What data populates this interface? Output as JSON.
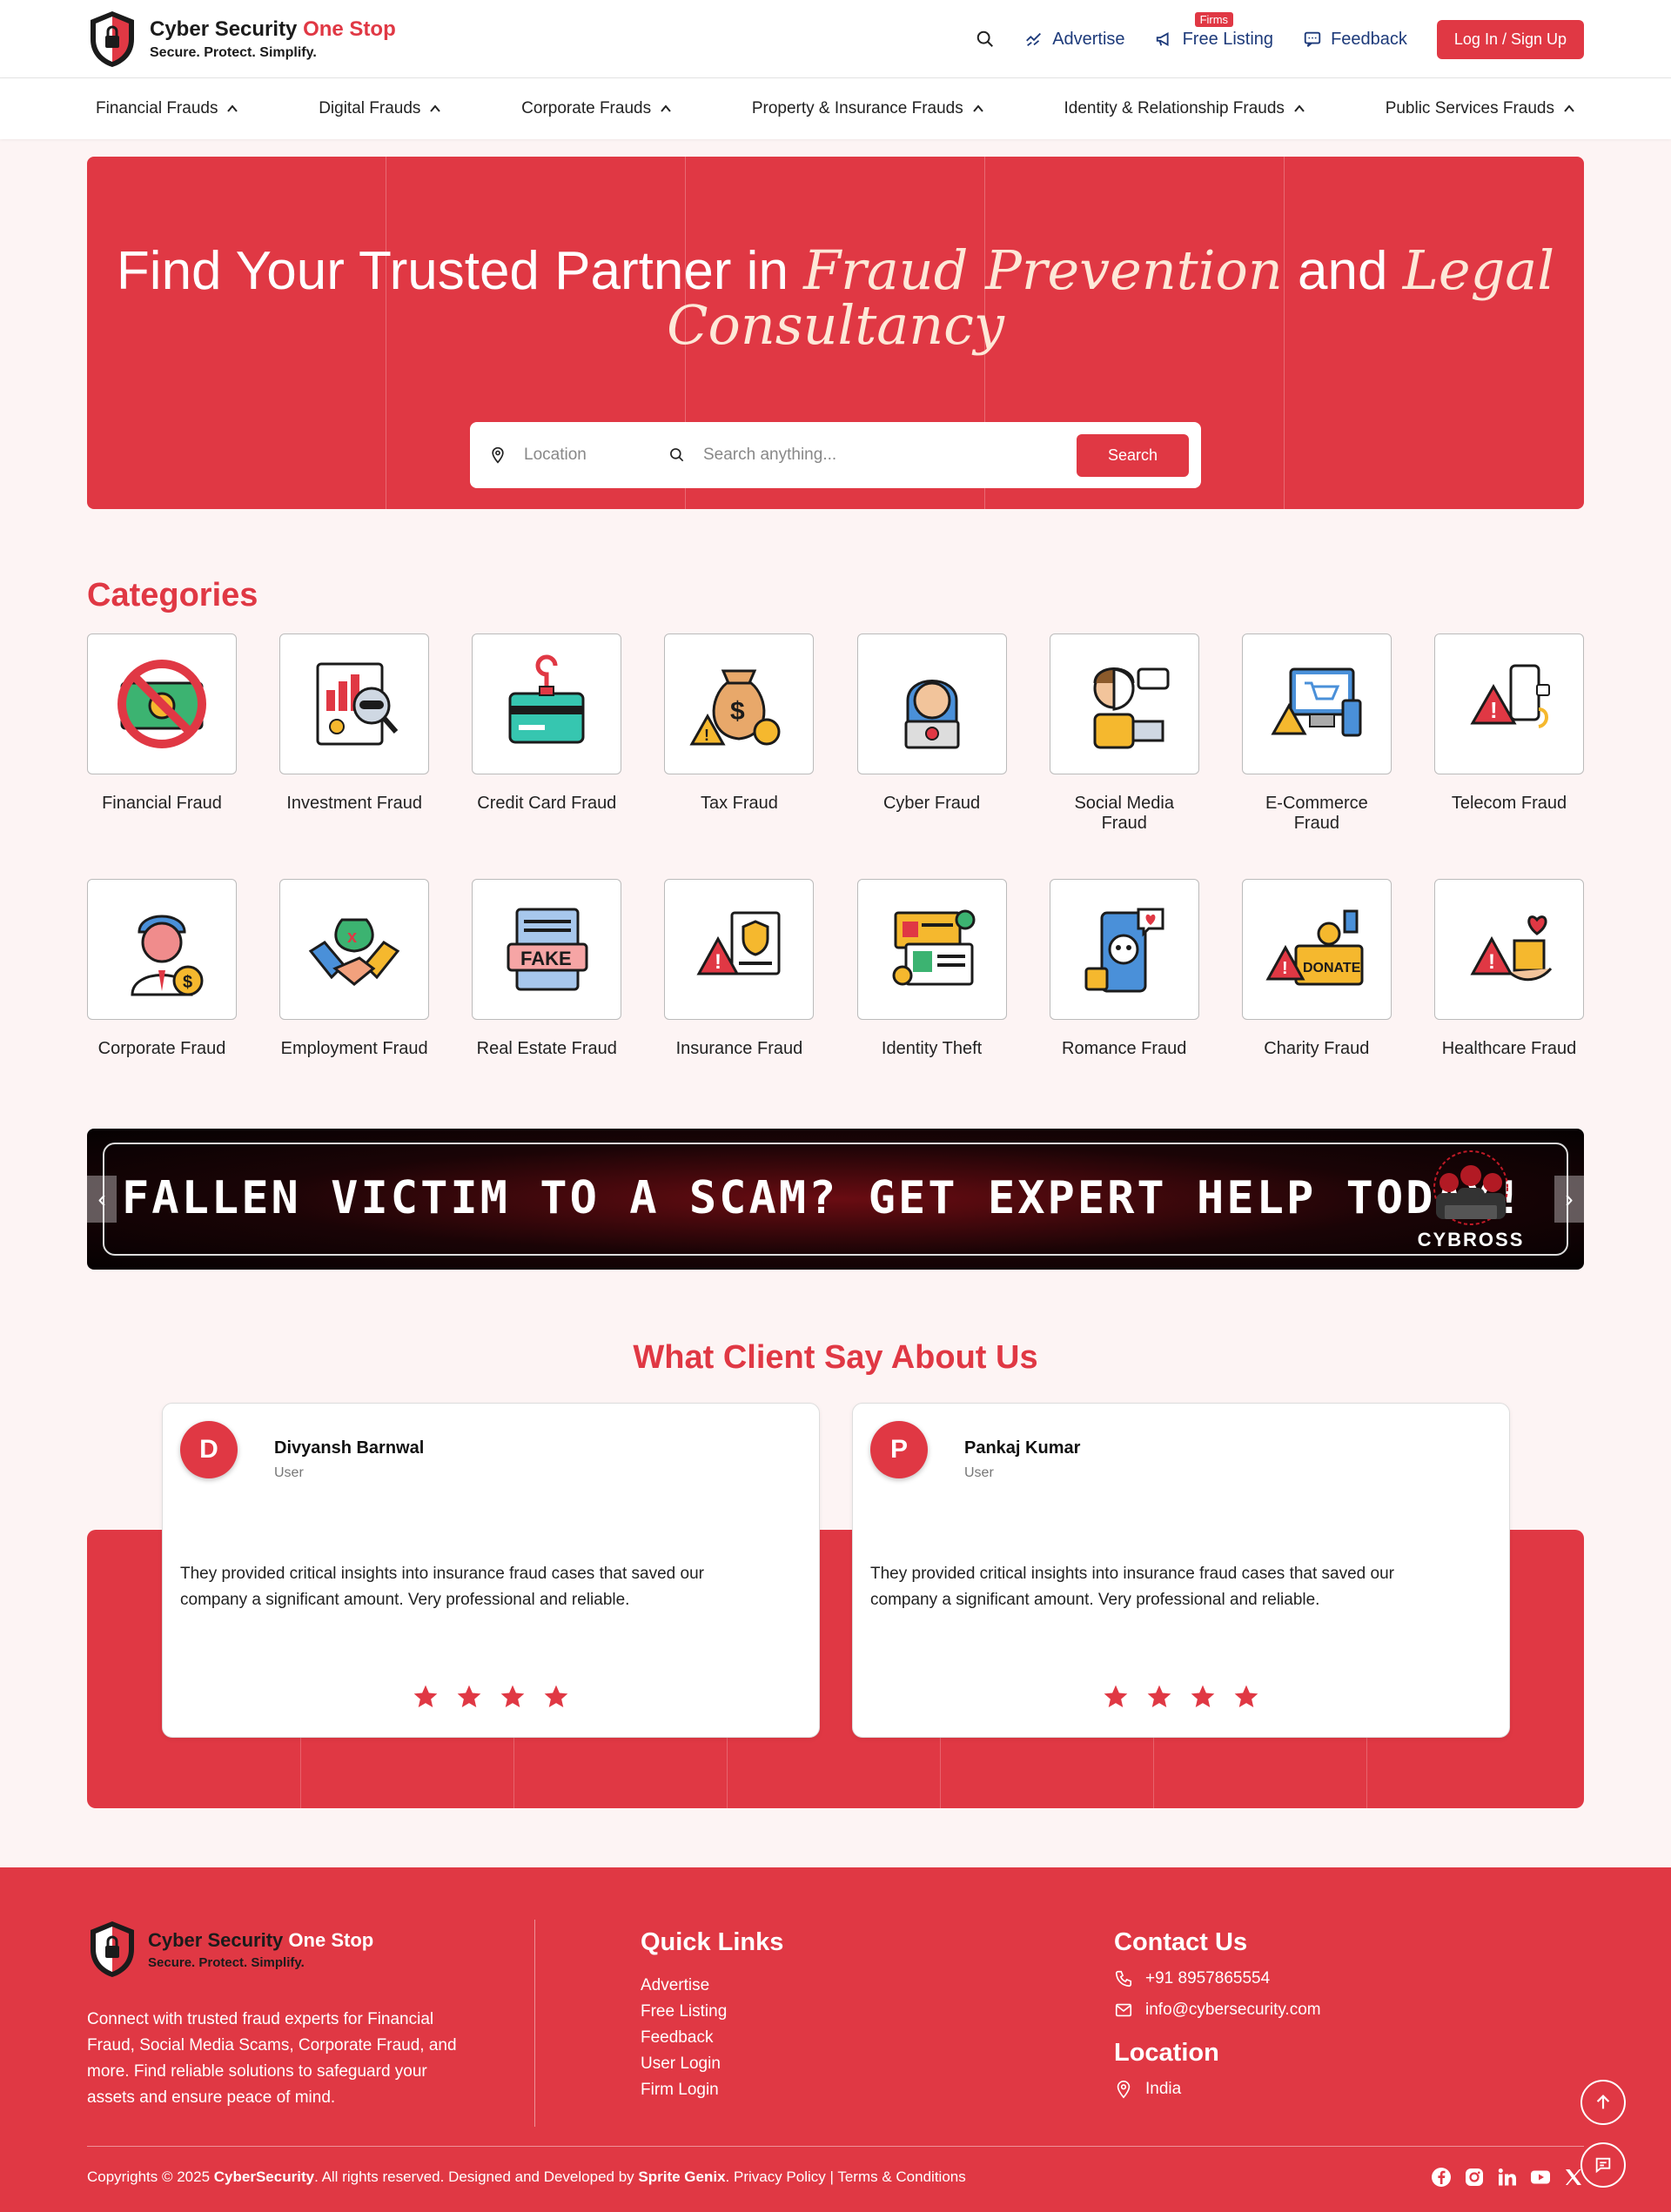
{
  "header": {
    "brand_main": "Cyber Security",
    "brand_accent": "One Stop",
    "tagline": "Secure. Protect. Simplify.",
    "advertise": "Advertise",
    "free_listing": "Free Listing",
    "firms_badge": "Firms",
    "feedback": "Feedback",
    "login": "Log In / Sign Up"
  },
  "nav": [
    "Financial Frauds",
    "Digital Frauds",
    "Corporate Frauds",
    "Property & Insurance Frauds",
    "Identity & Relationship Frauds",
    "Public Services Frauds"
  ],
  "hero": {
    "title_a": "Find Your Trusted Partner in ",
    "title_b": "Fraud Prevention",
    "title_c": " and ",
    "title_d": "Legal Consultancy",
    "location_placeholder": "Location",
    "search_placeholder": "Search anything...",
    "search_button": "Search"
  },
  "categories": {
    "title": "Categories",
    "items": [
      {
        "label": "Financial Fraud",
        "icon": "no-money-icon"
      },
      {
        "label": "Investment Fraud",
        "icon": "investment-report-icon"
      },
      {
        "label": "Credit Card Fraud",
        "icon": "credit-card-hook-icon"
      },
      {
        "label": "Tax Fraud",
        "icon": "money-bag-warning-icon"
      },
      {
        "label": "Cyber Fraud",
        "icon": "hacker-laptop-icon"
      },
      {
        "label": "Social Media Fraud",
        "icon": "social-media-mask-icon"
      },
      {
        "label": "E-Commerce Fraud",
        "icon": "ecommerce-warning-icon"
      },
      {
        "label": "Telecom Fraud",
        "icon": "phone-warning-icon"
      },
      {
        "label": "Corporate Fraud",
        "icon": "corporate-man-icon"
      },
      {
        "label": "Employment Fraud",
        "icon": "handshake-bag-icon"
      },
      {
        "label": "Real Estate Fraud",
        "icon": "fake-document-icon"
      },
      {
        "label": "Insurance Fraud",
        "icon": "insurance-warning-icon"
      },
      {
        "label": "Identity Theft",
        "icon": "identity-cards-icon"
      },
      {
        "label": "Romance Fraud",
        "icon": "romance-skull-phone-icon"
      },
      {
        "label": "Charity Fraud",
        "icon": "donate-box-icon"
      },
      {
        "label": "Healthcare Fraud",
        "icon": "healthcare-warning-icon"
      }
    ]
  },
  "banner": {
    "text": "FALLEN VICTIM TO A SCAM? GET EXPERT HELP TODAY!",
    "logo_text": "CYBROSS"
  },
  "testimonials": {
    "title": "What Client Say About Us",
    "items": [
      {
        "initial": "D",
        "name": "Divyansh Barnwal",
        "role": "User",
        "text": "They provided critical insights into insurance fraud cases that saved our company a significant amount. Very professional and reliable.",
        "stars": 4
      },
      {
        "initial": "P",
        "name": "Pankaj Kumar",
        "role": "User",
        "text": "They provided critical insights into insurance fraud cases that saved our company a significant amount. Very professional and reliable.",
        "stars": 4
      }
    ]
  },
  "footer": {
    "brand_main": "Cyber Security",
    "brand_accent": "One Stop",
    "tagline": "Secure. Protect. Simplify.",
    "description": "Connect with trusted fraud experts for Financial Fraud, Social Media Scams, Corporate Fraud, and more. Find reliable solutions to safeguard your assets and ensure peace of mind.",
    "quick_links_title": "Quick Links",
    "quick_links": [
      "Advertise",
      "Free Listing",
      "Feedback",
      "User Login",
      "Firm Login"
    ],
    "contact_title": "Contact Us",
    "phone": "+91 8957865554",
    "email": "info@cybersecurity.com",
    "location_title": "Location",
    "location": "India",
    "copy_a": "Copyrights © 2025 ",
    "copy_b": "CyberSecurity",
    "copy_c": ". All rights reserved. Designed and Developed by ",
    "copy_d": "Sprite Genix",
    "copy_e": ". Privacy Policy | Terms & Conditions"
  },
  "colors": {
    "accent": "#e03844",
    "nav_link": "#1d3a7a"
  }
}
